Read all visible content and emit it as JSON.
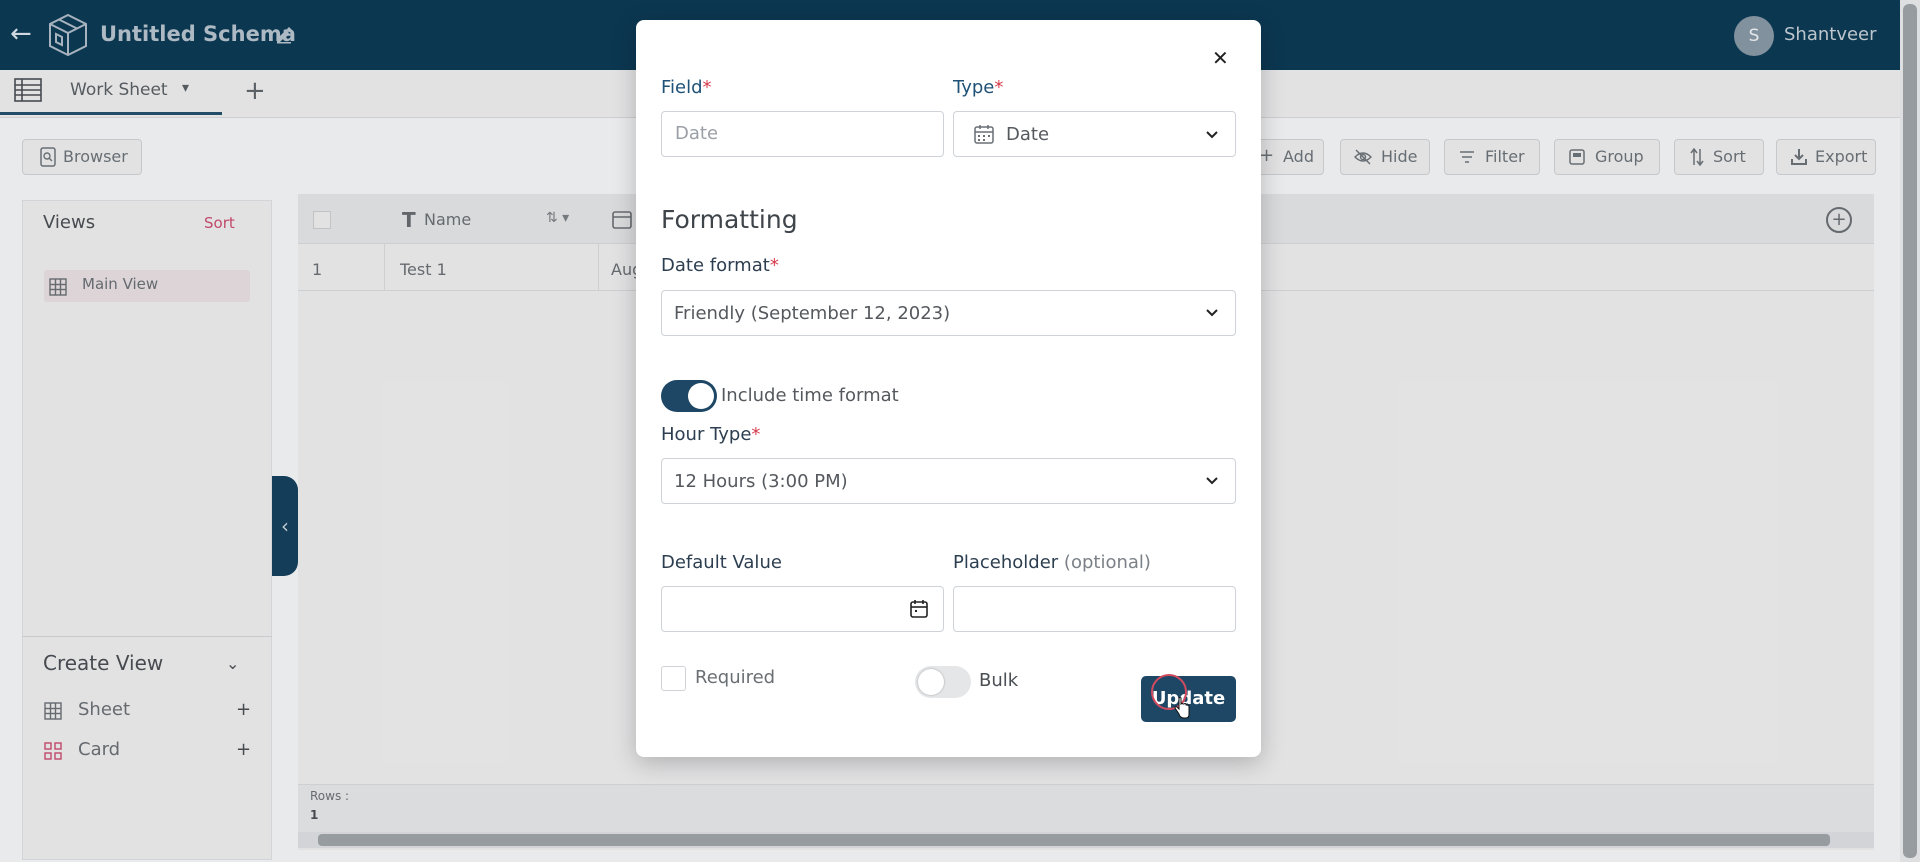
{
  "header": {
    "title": "Untitled Schema",
    "user_initial": "S",
    "user_name": "Shantveer"
  },
  "tabs": {
    "active": "Work Sheet"
  },
  "toolbar": {
    "browser": "Browser",
    "add": "Add",
    "hide": "Hide",
    "filter": "Filter",
    "group": "Group",
    "sort": "Sort",
    "export": "Export"
  },
  "sidebar": {
    "views_title": "Views",
    "views_sort": "Sort",
    "main_view": "Main View",
    "create_view_title": "Create View",
    "create_items": [
      "Sheet",
      "Card"
    ]
  },
  "grid": {
    "columns": [
      "Name"
    ],
    "rows": [
      {
        "num": "1",
        "name": "Test 1",
        "date": "Aug"
      }
    ],
    "rows_label": "Rows :",
    "rows_count": "1"
  },
  "modal": {
    "field_label": "Field",
    "field_placeholder": "Date",
    "type_label": "Type",
    "type_value": "Date",
    "formatting_title": "Formatting",
    "date_format_label": "Date format",
    "date_format_value": "Friendly (September 12, 2023)",
    "include_time_label": "Include time format",
    "include_time_on": true,
    "hour_type_label": "Hour Type",
    "hour_type_value": "12 Hours (3:00 PM)",
    "default_value_label": "Default Value",
    "placeholder_label": "Placeholder",
    "placeholder_optional": "(optional)",
    "required_label": "Required",
    "bulk_label": "Bulk",
    "update_button": "Update"
  },
  "colors": {
    "header_bg": "#0d3a55",
    "primary": "#1d4764",
    "required_star": "#d63a4a",
    "accent_sort": "#c94c6e"
  }
}
